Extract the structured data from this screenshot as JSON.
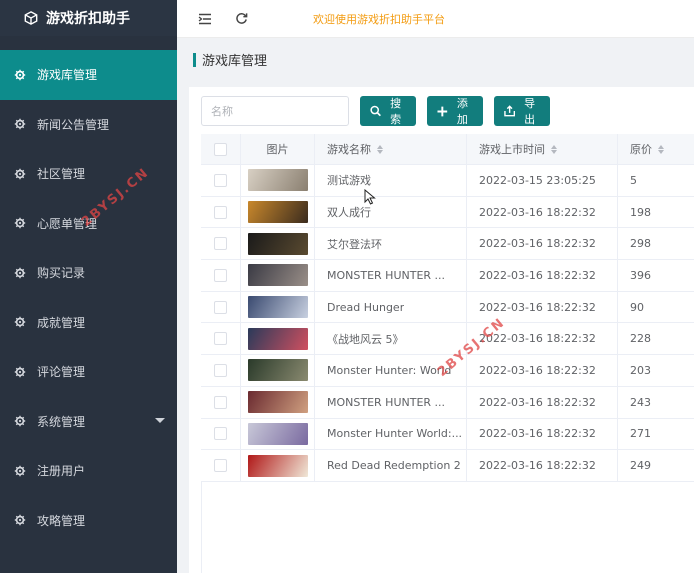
{
  "app": {
    "title": "游戏折扣助手"
  },
  "header": {
    "welcome": "欢迎使用游戏折扣助手平台"
  },
  "sidebar": {
    "items": [
      {
        "label": "游戏库管理",
        "active": true
      },
      {
        "label": "新闻公告管理"
      },
      {
        "label": "社区管理"
      },
      {
        "label": "心愿单管理"
      },
      {
        "label": "购买记录"
      },
      {
        "label": "成就管理"
      },
      {
        "label": "评论管理"
      },
      {
        "label": "系统管理",
        "has_children": true
      },
      {
        "label": "注册用户"
      },
      {
        "label": "攻略管理"
      }
    ]
  },
  "page": {
    "title": "游戏库管理"
  },
  "toolbar": {
    "search_placeholder": "名称",
    "search_label": "搜索",
    "add_label": "添加",
    "export_label": "导出"
  },
  "table": {
    "headers": {
      "image": "图片",
      "name": "游戏名称",
      "date": "游戏上市时间",
      "price": "原价"
    },
    "rows": [
      {
        "name": "测试游戏",
        "date": "2022-03-15 23:05:25",
        "price": "5",
        "thumb": [
          "#d8d0c4",
          "#8a7f70"
        ]
      },
      {
        "name": "双人成行",
        "date": "2022-03-16 18:22:32",
        "price": "198",
        "thumb": [
          "#c9882c",
          "#3a2b1e"
        ]
      },
      {
        "name": "艾尔登法环",
        "date": "2022-03-16 18:22:32",
        "price": "298",
        "thumb": [
          "#1a1a1a",
          "#5a4a30"
        ]
      },
      {
        "name": "MONSTER HUNTER ...",
        "date": "2022-03-16 18:22:32",
        "price": "396",
        "thumb": [
          "#3a3a44",
          "#9a8f88"
        ]
      },
      {
        "name": "Dread Hunger",
        "date": "2022-03-16 18:22:32",
        "price": "90",
        "thumb": [
          "#3a4a70",
          "#c8d0e0"
        ]
      },
      {
        "name": "《战地风云 5》",
        "date": "2022-03-16 18:22:32",
        "price": "228",
        "thumb": [
          "#2a3a5a",
          "#d05060"
        ]
      },
      {
        "name": "Monster Hunter: World",
        "date": "2022-03-16 18:22:32",
        "price": "203",
        "thumb": [
          "#2a3a2a",
          "#8a8a70"
        ]
      },
      {
        "name": "MONSTER HUNTER ...",
        "date": "2022-03-16 18:22:32",
        "price": "243",
        "thumb": [
          "#6a2a30",
          "#d0a080"
        ]
      },
      {
        "name": "Monster Hunter World:...",
        "date": "2022-03-16 18:22:32",
        "price": "271",
        "thumb": [
          "#c8c8d8",
          "#7a6aa0"
        ]
      },
      {
        "name": "Red Dead Redemption 2",
        "date": "2022-03-16 18:22:32",
        "price": "249",
        "thumb": [
          "#b01818",
          "#f0e8d8"
        ]
      }
    ]
  },
  "watermark": {
    "text": "2BYSJ.CN"
  },
  "colors": {
    "accent": "#127d7d",
    "sidebar_bg": "#29323f",
    "active_bg": "#0d8c8c",
    "welcome": "#f39c12"
  }
}
